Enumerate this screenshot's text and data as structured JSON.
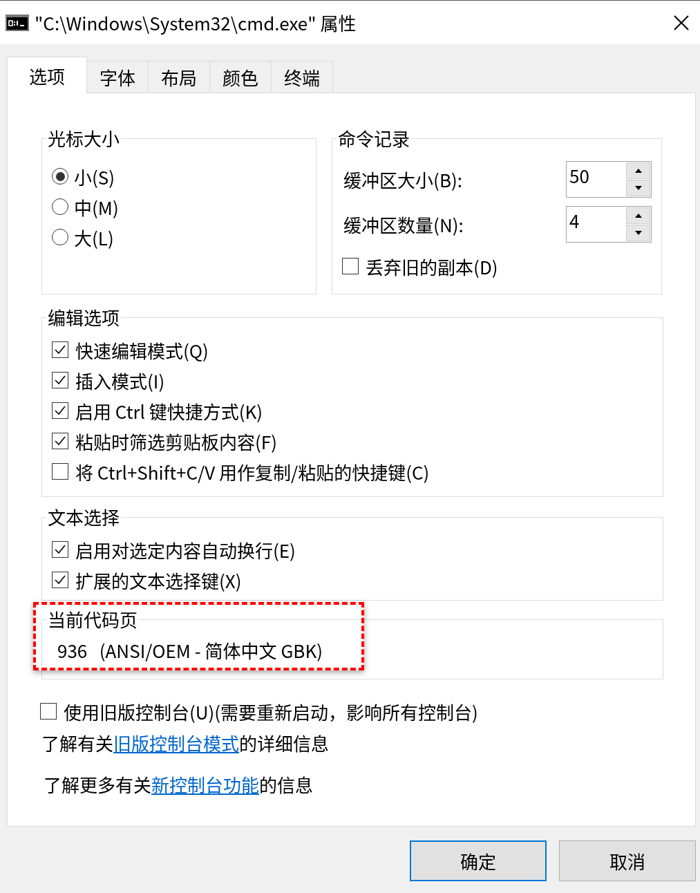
{
  "window": {
    "title": "\"C:\\Windows\\System32\\cmd.exe\" 属性"
  },
  "tabs": [
    {
      "label": "选项",
      "selected": true
    },
    {
      "label": "字体",
      "selected": false
    },
    {
      "label": "布局",
      "selected": false
    },
    {
      "label": "颜色",
      "selected": false
    },
    {
      "label": "终端",
      "selected": false
    }
  ],
  "cursor_size": {
    "title": "光标大小",
    "options": [
      {
        "label": "小(S)",
        "selected": true
      },
      {
        "label": "中(M)",
        "selected": false
      },
      {
        "label": "大(L)",
        "selected": false
      }
    ]
  },
  "command_history": {
    "title": "命令记录",
    "spinners": [
      {
        "label": "缓冲区大小(B):",
        "value": "50"
      },
      {
        "label": "缓冲区数量(N):",
        "value": "4"
      }
    ],
    "discard": {
      "label": "丢弃旧的副本(D)",
      "checked": false
    }
  },
  "edit_options": {
    "title": "编辑选项",
    "options": [
      {
        "label": "快速编辑模式(Q)",
        "checked": true
      },
      {
        "label": "插入模式(I)",
        "checked": true
      },
      {
        "label": "启用 Ctrl 键快捷方式(K)",
        "checked": true
      },
      {
        "label": "粘贴时筛选剪贴板内容(F)",
        "checked": true
      },
      {
        "label": "将 Ctrl+Shift+C/V 用作复制/粘贴的快捷键(C)",
        "checked": false
      }
    ]
  },
  "text_selection": {
    "title": "文本选择",
    "options": [
      {
        "label": "启用对选定内容自动换行(E)",
        "checked": true
      },
      {
        "label": "扩展的文本选择键(X)",
        "checked": true
      }
    ]
  },
  "code_page": {
    "title": "当前代码页",
    "value": "936   (ANSI/OEM - 简体中文 GBK)",
    "highlighted": true
  },
  "legacy": {
    "label": "使用旧版控制台(U)(需要重新启动，影响所有控制台)",
    "checked": false
  },
  "links": [
    {
      "before": "了解有关",
      "link": "旧版控制台模式",
      "after": "的详细信息"
    },
    {
      "before": "了解更多有关",
      "link": "新控制台功能",
      "after": "的信息"
    }
  ],
  "buttons": [
    {
      "label": "确定",
      "default": true
    },
    {
      "label": "取消",
      "default": false
    }
  ]
}
